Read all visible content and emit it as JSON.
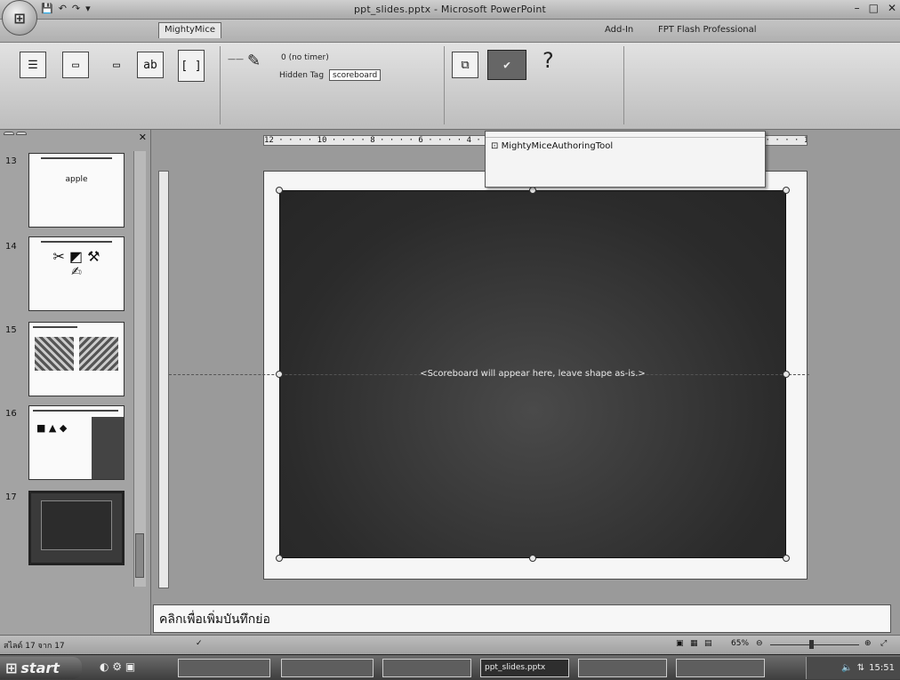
{
  "window": {
    "title": "ppt_slides.pptx - Microsoft PowerPoint",
    "office_button_glyph": "⊞",
    "controls": [
      "–",
      "□",
      "✕"
    ]
  },
  "quick_access": [
    "💾",
    "↶",
    "↷",
    "▾"
  ],
  "tabs": [
    "",
    "",
    "MightyMice",
    "",
    "",
    "",
    "",
    "",
    "Add-In",
    "FPT Flash Professional",
    ""
  ],
  "ribbon": {
    "group1": {
      "label": "",
      "labels": [
        "",
        "",
        "",
        "",
        ""
      ]
    },
    "group2": {
      "label": "",
      "option_text": "0 (no timer)",
      "hidden_tag_label": "Hidden Tag",
      "hidden_tag_value": "scoreboard"
    },
    "group3": {
      "label": "",
      "labels": [
        "",
        "",
        ""
      ]
    }
  },
  "tooltip": {
    "title": "",
    "item": "MightyMiceAuthoringTool",
    "sub": ""
  },
  "pane": {
    "tabs": [
      "",
      ""
    ],
    "close": "✕",
    "slides": [
      {
        "num": "13",
        "caption": "apple"
      },
      {
        "num": "14",
        "caption": ""
      },
      {
        "num": "15",
        "caption": ""
      },
      {
        "num": "16",
        "caption": ""
      },
      {
        "num": "17",
        "caption": ""
      }
    ]
  },
  "slide": {
    "placeholder_text": "<Scoreboard will appear here, leave shape as-is.>"
  },
  "ruler_top": "12 · · · · 10 · · · · 8 · · · · 6 · · · · 4 · · · · 2 · · · · 0 · · · · 2 · · · · 4 · · · · 6 · · · · 8 · · · · 10 · · · · 12",
  "notes": "คลิกเพื่อเพิ่มบันทึกย่อ",
  "status": {
    "slide_info": "สไลด์ 17 จาก 17",
    "theme": "",
    "language": "",
    "zoom": "65%"
  },
  "taskbar": {
    "start": "start",
    "buttons": [
      "",
      "",
      "",
      "ppt_slides.pptx",
      "",
      ""
    ],
    "clock": "15:51"
  }
}
